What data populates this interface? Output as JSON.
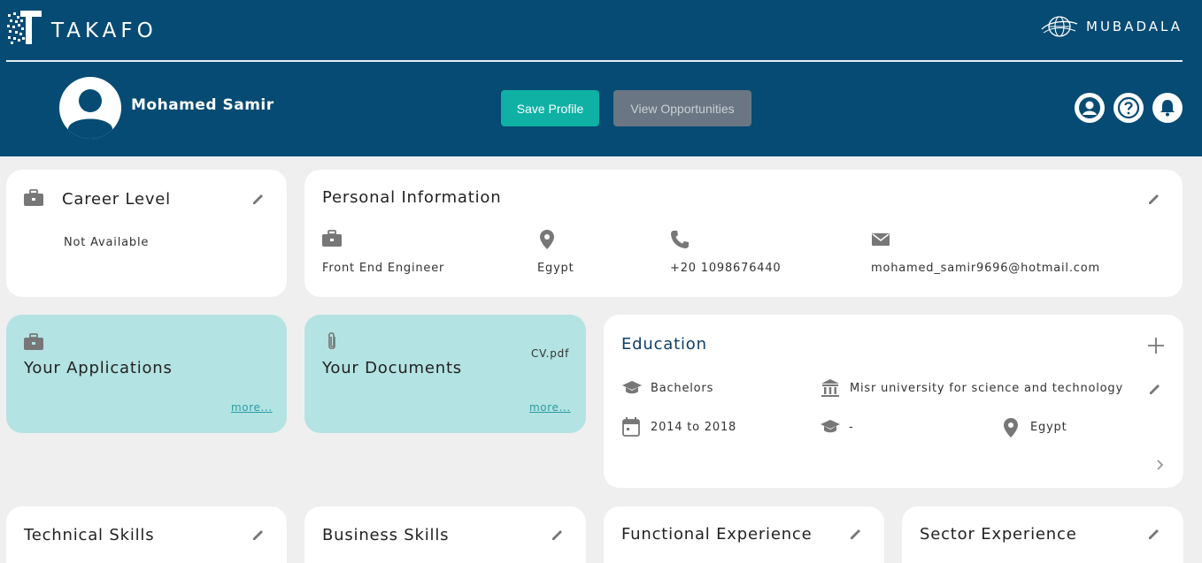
{
  "brand": {
    "name": "TAKAFO",
    "partner": "MUBADALA"
  },
  "user": {
    "name": "Mohamed Samir"
  },
  "actions": {
    "save_label": "Save Profile",
    "view_label": "View Opportunities"
  },
  "career": {
    "title": "Career Level",
    "value": "Not Available"
  },
  "personal": {
    "title": "Personal Information",
    "job": "Front End Engineer",
    "country": "Egypt",
    "phone": "+20 1098676440",
    "email": "mohamed_samir9696@hotmail.com"
  },
  "applications": {
    "title": "Your Applications",
    "more": "more..."
  },
  "documents": {
    "title": "Your Documents",
    "file": "CV.pdf",
    "more": "more..."
  },
  "education": {
    "title": "Education",
    "degree": "Bachelors",
    "institution": "Misr university for science and technology",
    "years": "2014 to 2018",
    "field": "-",
    "country": "Egypt"
  },
  "skills": {
    "technical": "Technical Skills",
    "business": "Business Skills",
    "functional": "Functional Experience",
    "sector": "Sector Experience"
  },
  "colors": {
    "header": "#064b74",
    "accent": "#0fb1a5",
    "teal_card": "#b3e3e2",
    "muted_button": "#6a7683"
  },
  "icons": [
    "logo-mark",
    "globe-icon",
    "user-circle-icon",
    "help-icon",
    "bell-icon",
    "briefcase-icon",
    "pencil-icon",
    "location-pin-icon",
    "phone-icon",
    "envelope-icon",
    "paperclip-icon",
    "graduation-cap-icon",
    "institution-icon",
    "calendar-icon",
    "plus-icon",
    "chevron-right-icon"
  ]
}
